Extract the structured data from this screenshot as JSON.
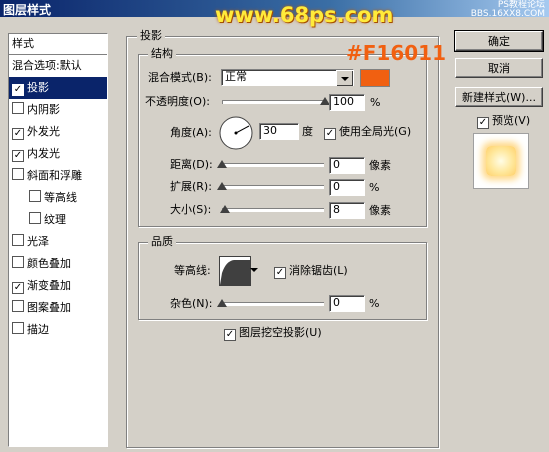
{
  "window": {
    "title": "图层样式"
  },
  "watermark": {
    "main": "www.68ps.com",
    "corner_line1": "PS教程论坛",
    "corner_line2": "BBS.16XX8.COM"
  },
  "annotation": {
    "text": "#F16011",
    "color": "#F16011"
  },
  "styles_list": {
    "header": "样式",
    "items": [
      {
        "label": "混合选项:默认",
        "has_checkbox": false,
        "checked": false,
        "selected": false,
        "indent": 0
      },
      {
        "label": "投影",
        "has_checkbox": true,
        "checked": true,
        "selected": true,
        "indent": 0
      },
      {
        "label": "内阴影",
        "has_checkbox": true,
        "checked": false,
        "selected": false,
        "indent": 0
      },
      {
        "label": "外发光",
        "has_checkbox": true,
        "checked": true,
        "selected": false,
        "indent": 0
      },
      {
        "label": "内发光",
        "has_checkbox": true,
        "checked": true,
        "selected": false,
        "indent": 0
      },
      {
        "label": "斜面和浮雕",
        "has_checkbox": true,
        "checked": false,
        "selected": false,
        "indent": 0
      },
      {
        "label": "等高线",
        "has_checkbox": true,
        "checked": false,
        "selected": false,
        "indent": 1
      },
      {
        "label": "纹理",
        "has_checkbox": true,
        "checked": false,
        "selected": false,
        "indent": 1
      },
      {
        "label": "光泽",
        "has_checkbox": true,
        "checked": false,
        "selected": false,
        "indent": 0
      },
      {
        "label": "颜色叠加",
        "has_checkbox": true,
        "checked": false,
        "selected": false,
        "indent": 0
      },
      {
        "label": "渐变叠加",
        "has_checkbox": true,
        "checked": true,
        "selected": false,
        "indent": 0
      },
      {
        "label": "图案叠加",
        "has_checkbox": true,
        "checked": false,
        "selected": false,
        "indent": 0
      },
      {
        "label": "描边",
        "has_checkbox": true,
        "checked": false,
        "selected": false,
        "indent": 0
      }
    ]
  },
  "shadow": {
    "title": "投影",
    "structure": {
      "title": "结构",
      "blend_mode_label": "混合模式(B):",
      "blend_mode_value": "正常",
      "color": "#F16011",
      "opacity_label": "不透明度(O):",
      "opacity_value": "100",
      "opacity_unit": "%",
      "opacity_level": 1.0,
      "angle_label": "角度(A):",
      "angle_value": "30",
      "angle_unit": "度",
      "global_light_label": "使用全局光(G)",
      "global_light_checked": true,
      "distance_label": "距离(D):",
      "distance_value": "0",
      "distance_unit": "像素",
      "distance_level": 0.0,
      "spread_label": "扩展(R):",
      "spread_value": "0",
      "spread_unit": "%",
      "spread_level": 0.0,
      "size_label": "大小(S):",
      "size_value": "8",
      "size_unit": "像素",
      "size_level": 0.032
    },
    "quality": {
      "title": "品质",
      "contour_label": "等高线:",
      "antialias_label": "消除锯齿(L)",
      "antialias_checked": true,
      "noise_label": "杂色(N):",
      "noise_value": "0",
      "noise_unit": "%",
      "noise_level": 0.0
    },
    "knockout_label": "图层挖空投影(U)",
    "knockout_checked": true
  },
  "buttons": {
    "ok": "确定",
    "cancel": "取消",
    "new_style": "新建样式(W)...",
    "preview_label": "预览(V)",
    "preview_checked": true
  }
}
